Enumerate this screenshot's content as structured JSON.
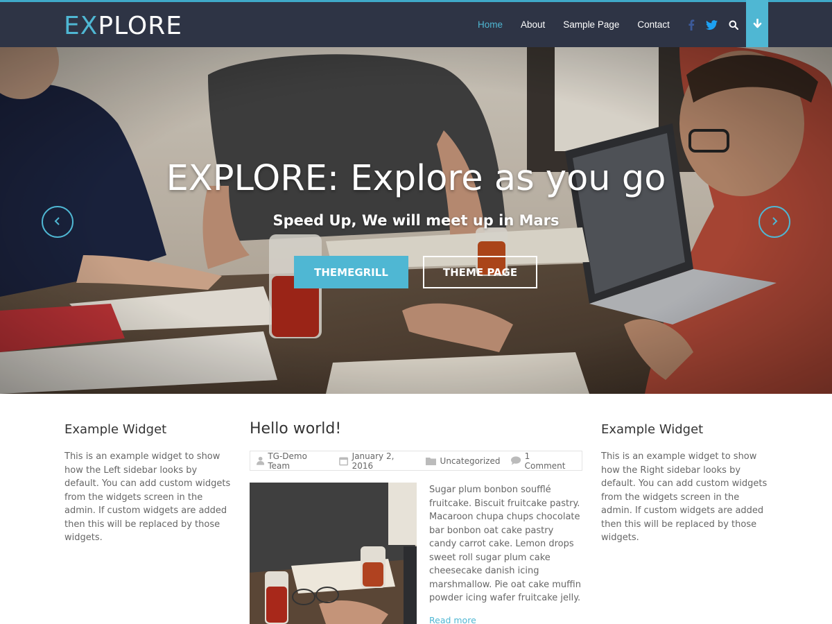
{
  "header": {
    "logo_accent": "EX",
    "logo_rest": "PLORE",
    "nav": [
      "Home",
      "About",
      "Sample Page",
      "Contact"
    ],
    "active_nav": "Home",
    "icons": [
      "facebook-icon",
      "twitter-icon",
      "search-icon",
      "arrow-down-icon"
    ],
    "colors": {
      "bar": "#2e3445",
      "accent": "#4fb7d3"
    }
  },
  "hero": {
    "title": "EXPLORE: Explore as you go",
    "subtitle": "Speed Up, We will meet up in Mars",
    "primary_button": "THEMEGRILL",
    "secondary_button": "THEME PAGE",
    "icons": [
      "chevron-left-icon",
      "chevron-right-icon"
    ]
  },
  "left_sidebar": {
    "title": "Example Widget",
    "text": "This is an example widget to show how the Left sidebar looks by default. You can add custom widgets from the widgets screen in the admin. If custom widgets are added then this will be replaced by those widgets."
  },
  "post": {
    "title": "Hello world!",
    "author": "TG-Demo Team",
    "date": "January 2, 2016",
    "category": "Uncategorized",
    "comments": "1 Comment",
    "excerpt": "Sugar plum bonbon soufflé fruitcake. Biscuit fruitcake pastry. Macaroon chupa chups chocolate bar bonbon oat cake pastry candy carrot cake. Lemon drops sweet roll sugar plum cake cheesecake danish icing marshmallow. Pie oat cake muffin powder icing wafer fruitcake jelly.",
    "read_more": "Read more"
  },
  "right_sidebar": {
    "title": "Example Widget",
    "text": "This is an example widget to show how the Right sidebar looks by default. You can add custom widgets from the widgets screen in the admin. If custom widgets are added then this will be replaced by those widgets."
  }
}
